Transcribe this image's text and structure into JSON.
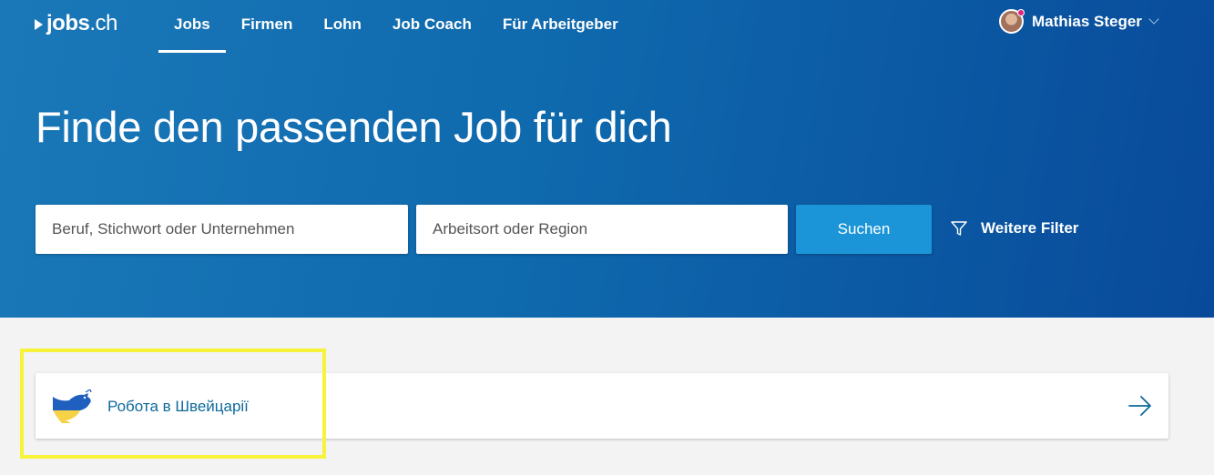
{
  "header": {
    "logo_main": "jobs",
    "logo_tld": ".ch",
    "nav": [
      {
        "label": "Jobs",
        "active": true
      },
      {
        "label": "Firmen"
      },
      {
        "label": "Lohn"
      },
      {
        "label": "Job Coach"
      },
      {
        "label": "Für Arbeitgeber"
      }
    ],
    "user_name": "Mathias Steger"
  },
  "hero": {
    "title": "Finde den passenden Job für dich",
    "search": {
      "keyword_placeholder": "Beruf, Stichwort oder Unternehmen",
      "location_placeholder": "Arbeitsort oder Region",
      "button_label": "Suchen"
    },
    "filter_label": "Weitere Filter"
  },
  "banner": {
    "label": "Робота в Швейцарії",
    "icon": "dove-icon",
    "colors": {
      "blue": "#1f5fbd",
      "yellow": "#f6d346"
    }
  },
  "colors": {
    "hero_start": "#1a78b8",
    "hero_end": "#084a9a",
    "search_button": "#1b95d8",
    "highlight": "#f7f33a",
    "banner_text": "#0e6a9c"
  }
}
